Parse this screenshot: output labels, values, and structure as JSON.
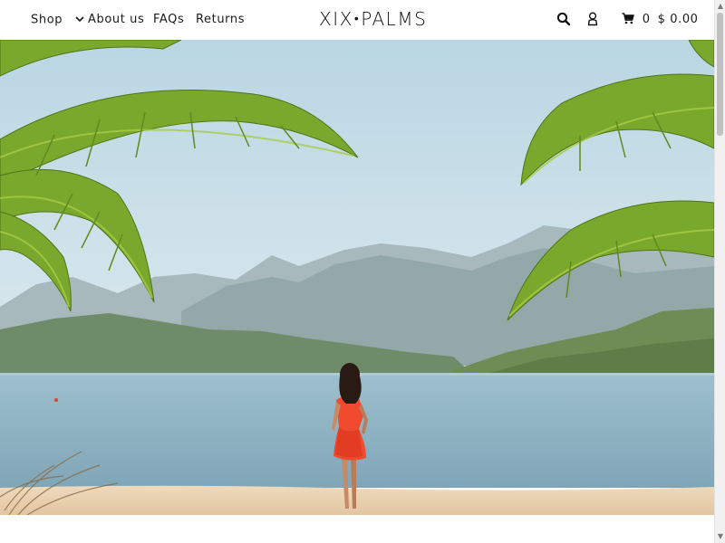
{
  "header": {
    "nav": {
      "shop": "Shop",
      "about": "About us",
      "faqs": "FAQs",
      "returns": "Returns"
    },
    "logo": {
      "left": "XIX",
      "right": "PALMS"
    },
    "cart": {
      "count": "0",
      "total": "$ 0.00"
    },
    "icons": [
      "chevron-down-icon",
      "search-icon",
      "account-icon",
      "cart-icon"
    ]
  },
  "hero": {
    "image": "beach-palms-woman-red-dress-mountains"
  },
  "colors": {
    "text": "#1a1a1a",
    "header_bg": "#ffffff",
    "sky": "#c7dde6",
    "water": "#8fb2c2",
    "sand": "#e9d3b3",
    "dress": "#f04a2f",
    "palm": "#6e9d28"
  }
}
